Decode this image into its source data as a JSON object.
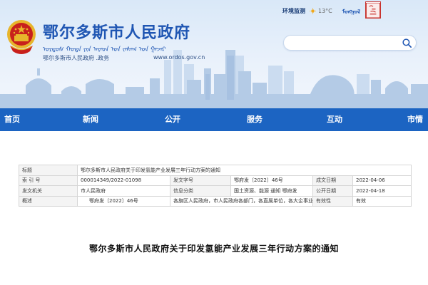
{
  "header": {
    "site_title": "鄂尔多斯市人民政府",
    "mongol_name": "ᠣᠷᠳᠣᠰ ᠬᠣᠲᠠ ᠶᠢᠨ ᠠᠷᠠᠳ ᠤᠨ ᠵᠠᠰᠠᠭ ᠤᠨ ᠭᠠᠵᠠᠷ",
    "sub_name": "鄂尔多斯市人民政府 .政务",
    "domain": "www.ordos.gov.cn",
    "env_label": "环境监测",
    "temperature": "13°C",
    "mongol_link": "ᠮᠣᠩᠭᠣᠯ",
    "chinese_link": "中文",
    "seal_text": "鄂尔 多斯",
    "search": {
      "value": "",
      "placeholder": ""
    }
  },
  "nav": {
    "items": [
      {
        "label": "首页"
      },
      {
        "label": "新闻"
      },
      {
        "label": "公开"
      },
      {
        "label": "服务"
      },
      {
        "label": "互动"
      },
      {
        "label": "市情"
      }
    ]
  },
  "meta": {
    "title_label": "标题",
    "title_value": "鄂尔多斯市人民政府关于印发氢能产业发展三年行动方案的通知",
    "index_label": "索 引 号",
    "index_value": "000014349/2022-01098",
    "doc_no_label": "发文字号",
    "doc_no_value": "鄂府发〔2022〕46号",
    "created_label": "成文日期",
    "created_value": "2022-04-06",
    "issuer_label": "发文机关",
    "issuer_value": "市人民政府",
    "category_label": "信息分类",
    "category_value": "国土资源、能源  通知  鄂府发",
    "published_label": "公开日期",
    "published_value": "2022-04-18",
    "summary_label": "概述",
    "summary_doc": "鄂府发〔2022〕46号",
    "summary_recipients": "各旗区人民政府，市人民政府各部门，各直属单位，各大企事业单",
    "validity_label": "有效性",
    "validity_value": "有效"
  },
  "article": {
    "title": "鄂尔多斯市人民政府关于印发氢能产业发展三年行动方案的通知"
  },
  "colors": {
    "nav_background": "#1c64c2",
    "title_blue": "#1f56b3",
    "emblem_red": "#c8201c",
    "emblem_gold": "#e7b52b"
  },
  "icons": [
    "national-emblem-icon",
    "sun-icon",
    "search-icon",
    "seal-logo"
  ]
}
